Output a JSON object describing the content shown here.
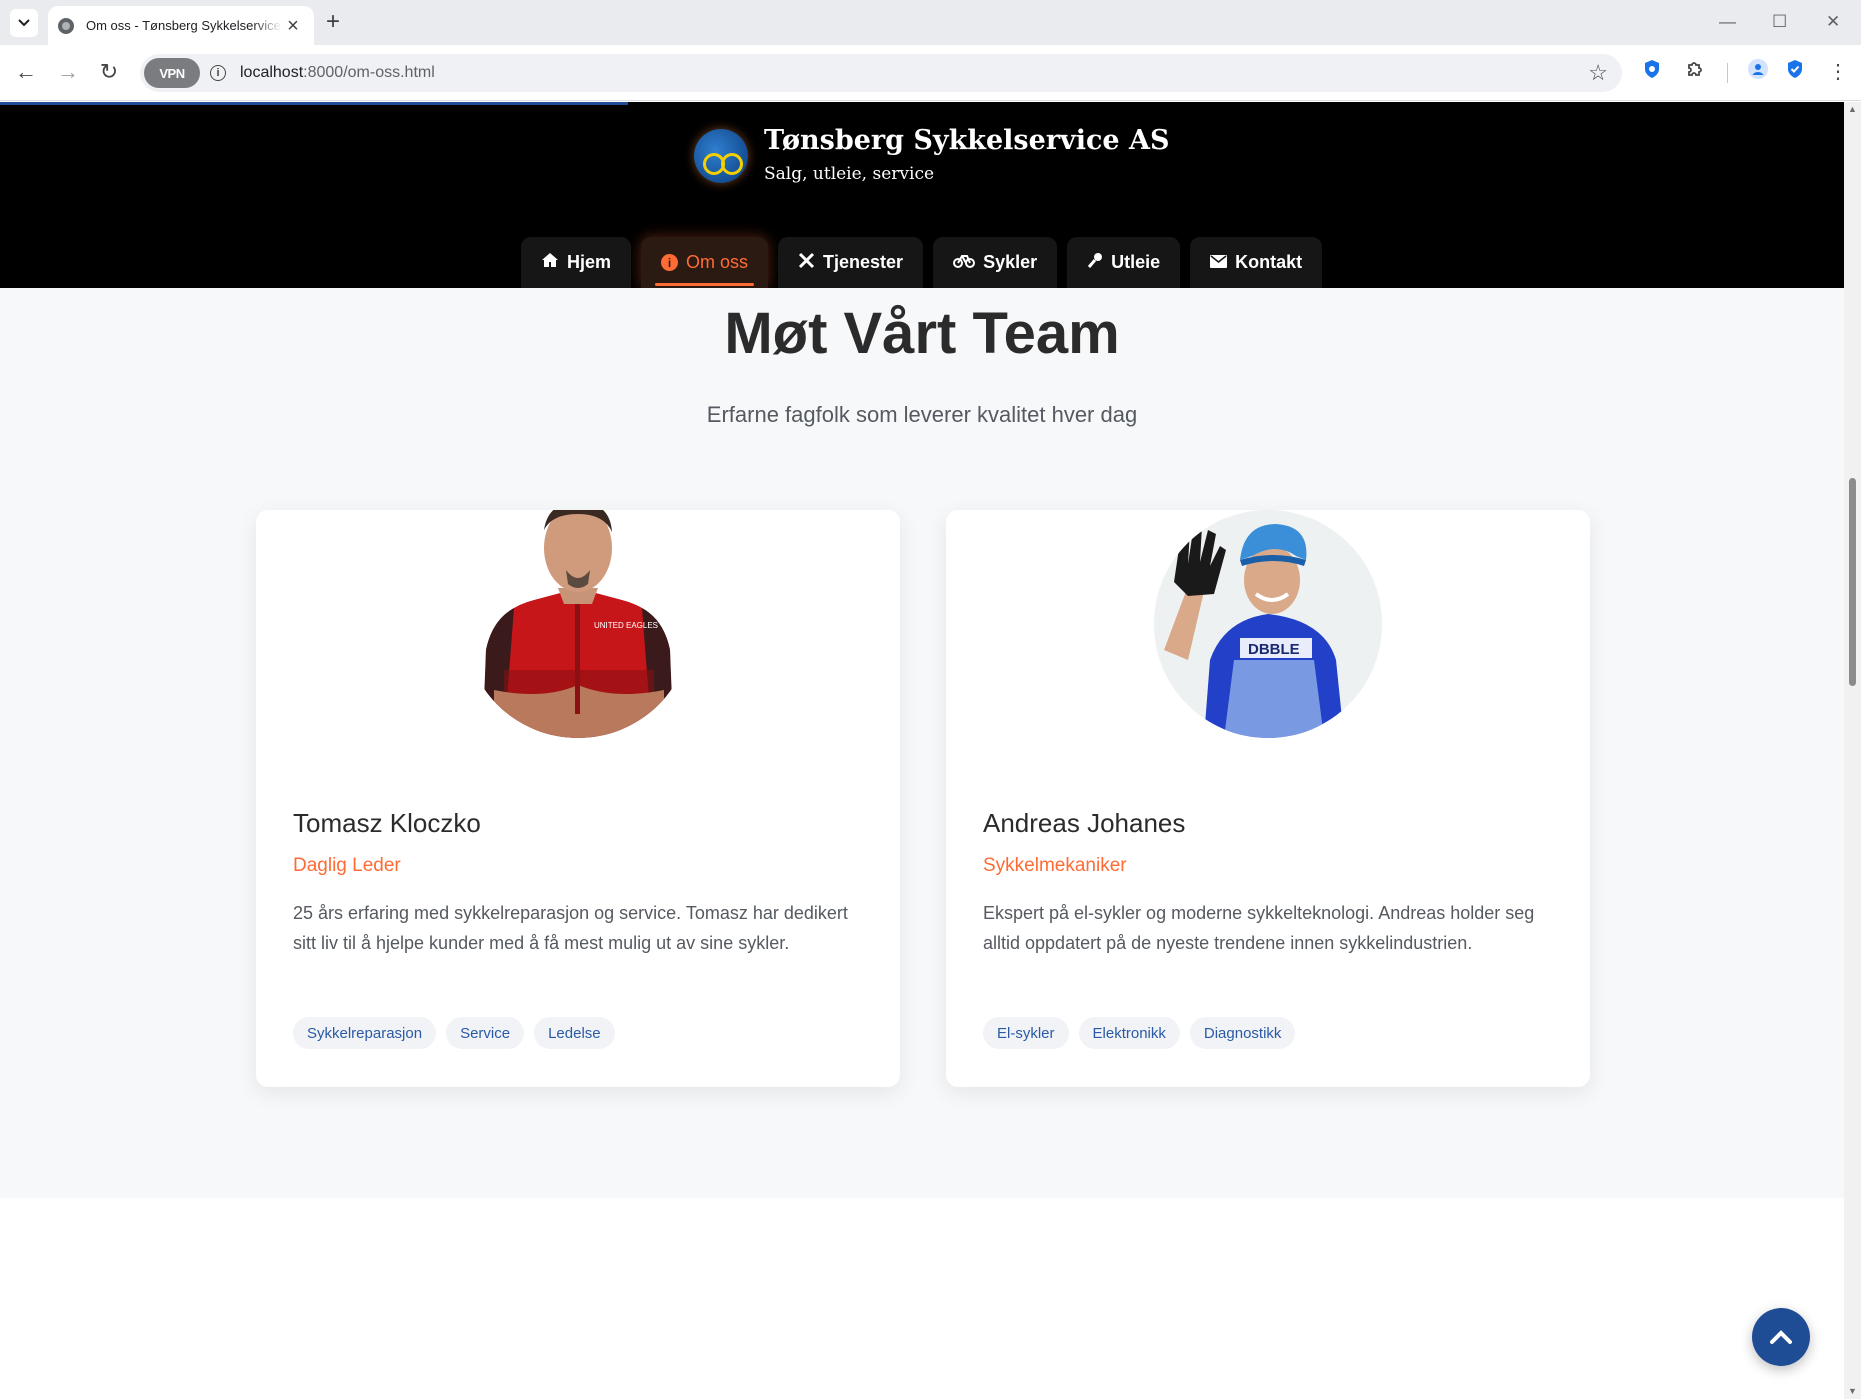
{
  "browser": {
    "tab_title": "Om oss - Tønsberg Sykkelservice AS",
    "new_tab_symbol": "+",
    "url_host": "localhost",
    "url_path": ":8000/om-oss.html",
    "vpn_label": "VPN"
  },
  "site": {
    "brand_name": "Tønsberg Sykkelservice AS",
    "brand_tagline": "Salg, utleie, service",
    "accent_color": "#ff6b35",
    "primary_color": "#1e4d95",
    "nav": [
      {
        "label": "Hjem",
        "icon": "home-icon",
        "active": false
      },
      {
        "label": "Om oss",
        "icon": "info-icon",
        "active": true
      },
      {
        "label": "Tjenester",
        "icon": "tools-icon",
        "active": false
      },
      {
        "label": "Sykler",
        "icon": "bicycle-icon",
        "active": false
      },
      {
        "label": "Utleie",
        "icon": "key-icon",
        "active": false
      },
      {
        "label": "Kontakt",
        "icon": "envelope-icon",
        "active": false
      }
    ]
  },
  "team": {
    "title": "Møt Vårt Team",
    "subtitle": "Erfarne fagfolk som leverer kvalitet hver dag",
    "members": [
      {
        "name": "Tomasz Kloczko",
        "role": "Daglig Leder",
        "bio": "25 års erfaring med sykkelreparasjon og service. Tomasz har dedikert sitt liv til å hjelpe kunder med å få mest mulig ut av sine sykler.",
        "tags": [
          "Sykkelreparasjon",
          "Service",
          "Ledelse"
        ]
      },
      {
        "name": "Andreas Johanes",
        "role": "Sykkelmekaniker",
        "bio": "Ekspert på el-sykler og moderne sykkelteknologi. Andreas holder seg alltid oppdatert på de nyeste trendene innen sykkelindustrien.",
        "tags": [
          "El-sykler",
          "Elektronikk",
          "Diagnostikk"
        ]
      }
    ]
  }
}
